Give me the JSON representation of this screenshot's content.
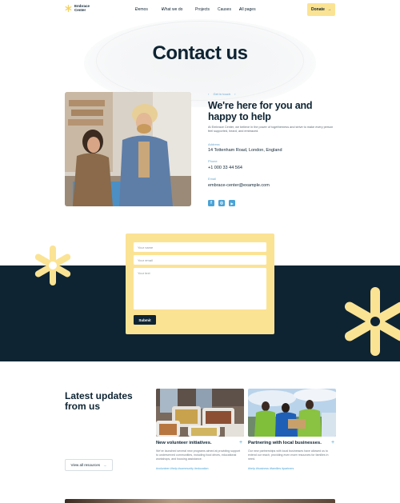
{
  "header": {
    "logo_text": "Embrace Center",
    "nav": [
      {
        "label": "Demos",
        "has_dropdown": true
      },
      {
        "label": "What we do",
        "has_dropdown": true
      },
      {
        "label": "Projects",
        "has_dropdown": false
      },
      {
        "label": "Causes",
        "has_dropdown": false
      },
      {
        "label": "All pages",
        "has_dropdown": true
      }
    ],
    "donate_label": "Donate"
  },
  "hero": {
    "title": "Contact us"
  },
  "contact": {
    "eyebrow": "Get in touch",
    "headline": "We're here for you and happy to help",
    "intro": "At Embrace Center, we believe in the power of togetherness and strive to make every person feel supported, heard, and embraced.",
    "address_label": "Address",
    "address": "14 Tottenham Road, London, England",
    "phone_label": "Phone",
    "phone": "+1 000 33 44 564",
    "email_label": "Email",
    "email": "embrace-center@example.com",
    "socials": [
      {
        "icon": "facebook-icon",
        "glyph": "f"
      },
      {
        "icon": "instagram-icon",
        "glyph": "◎"
      },
      {
        "icon": "youtube-icon",
        "glyph": "▶"
      }
    ]
  },
  "form": {
    "name_placeholder": "Your name",
    "email_placeholder": "Your email",
    "text_placeholder": "Your text",
    "submit_label": "Submit"
  },
  "updates": {
    "title": "Latest updates from us",
    "view_all_label": "View all resources",
    "posts": [
      {
        "title": "New volunteer initiatives.",
        "description": "We've launched several new programs aimed at providing support to underserved communities, including food drives, educational workshops, and housing assistance.",
        "tags": "#volunteer #help #community #education"
      },
      {
        "title": "Partnering with local businesses.",
        "description": "Our new partnerships with local businesses have allowed us to extend our reach, providing even more resources for families in need.",
        "tags": "#help #business #families #partners"
      }
    ]
  },
  "colors": {
    "navy": "#0e2433",
    "yellow": "#fbe394",
    "accent_blue": "#4aa3d6"
  }
}
